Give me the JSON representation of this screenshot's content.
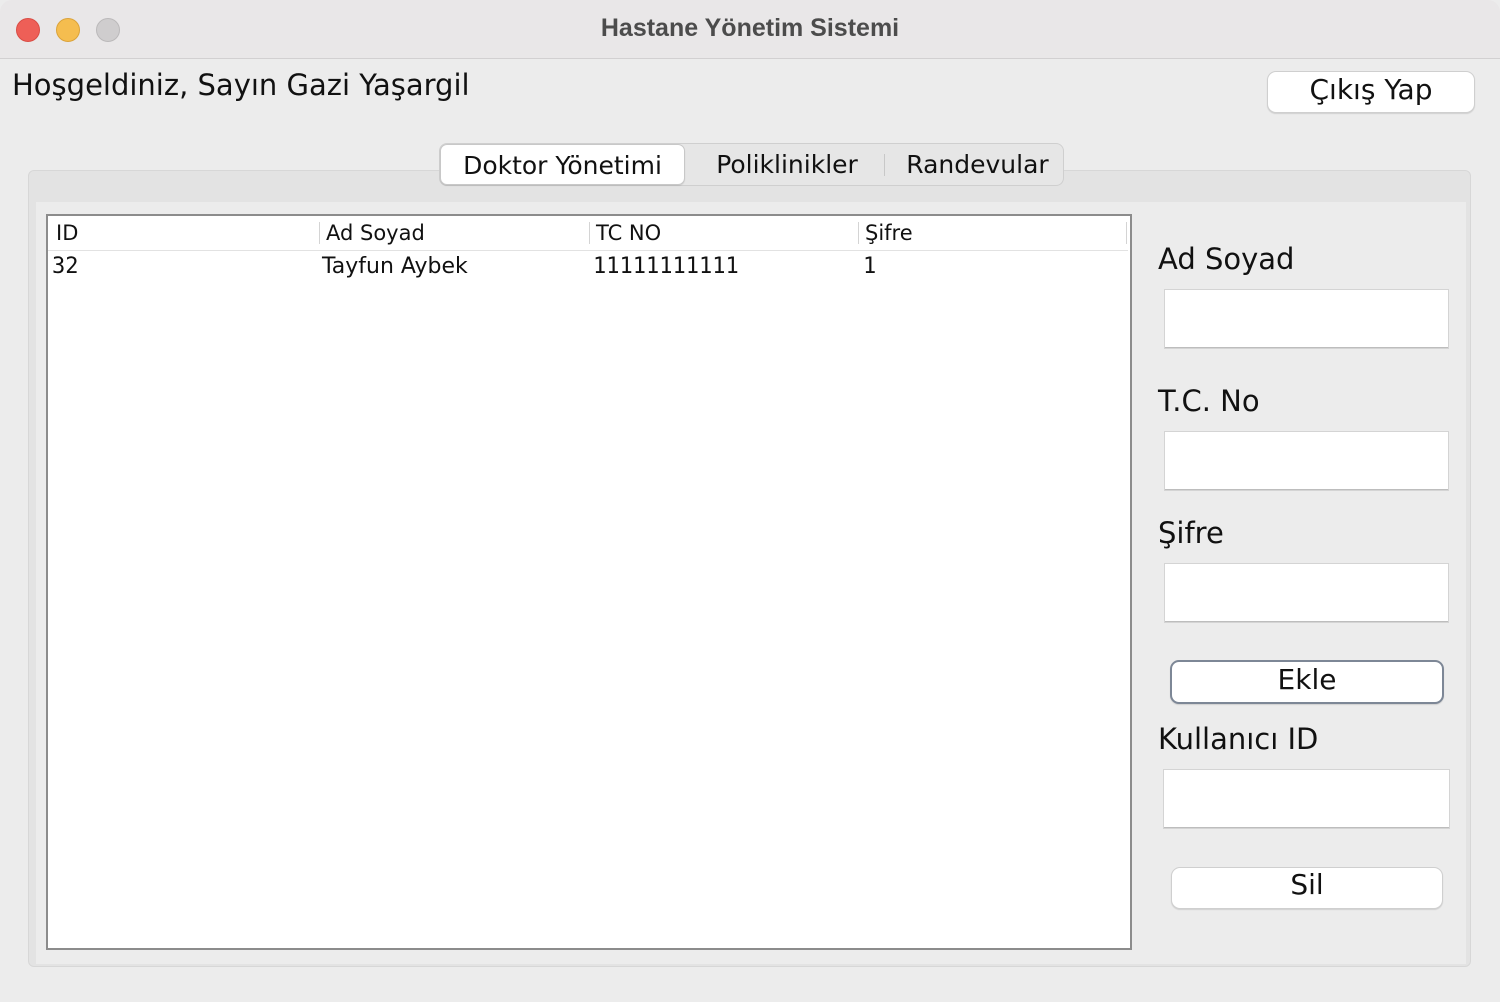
{
  "window": {
    "title": "Hastane Yönetim Sistemi"
  },
  "header": {
    "welcome": "Hoşgeldiniz, Sayın Gazi Yaşargil",
    "logout_label": "Çıkış Yap"
  },
  "tabs": [
    {
      "label": "Doktor Yönetimi",
      "active": true
    },
    {
      "label": "Poliklinikler",
      "active": false
    },
    {
      "label": "Randevular",
      "active": false
    }
  ],
  "table": {
    "columns": [
      "ID",
      "Ad Soyad",
      "TC NO",
      "Şifre"
    ],
    "rows": [
      [
        "32",
        "Tayfun Aybek",
        "11111111111",
        "1"
      ]
    ]
  },
  "form": {
    "name_label": "Ad Soyad",
    "name_value": "",
    "tc_label": "T.C. No",
    "tc_value": "",
    "password_label": "Şifre",
    "password_value": "",
    "add_label": "Ekle",
    "user_id_label": "Kullanıcı ID",
    "user_id_value": "",
    "delete_label": "Sil"
  }
}
